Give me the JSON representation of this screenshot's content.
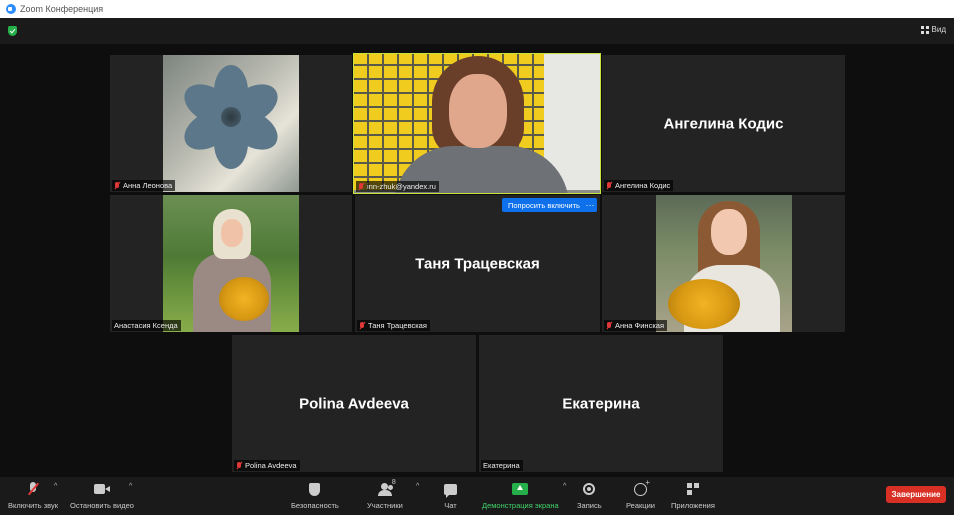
{
  "window": {
    "title": "Zoom Конференция"
  },
  "topbar": {
    "view_label": "Вид"
  },
  "participants": [
    {
      "name": "Анна Леонова",
      "video": true,
      "muted": true
    },
    {
      "name": "inn-zhuk@yandex.ru",
      "video": true,
      "muted": true,
      "active_speaker": true
    },
    {
      "name": "Ангелина Кодис",
      "video": false,
      "muted": true
    },
    {
      "name": "Анастасия Ксенда",
      "video": true,
      "muted": false
    },
    {
      "name": "Таня Трацевская",
      "video": false,
      "muted": true
    },
    {
      "name": "Анна Финская",
      "video": true,
      "muted": true
    },
    {
      "name": "Polina Avdeeva",
      "video": false,
      "muted": true
    },
    {
      "name": "Екатерина",
      "video": false,
      "muted": false
    }
  ],
  "tile_actions": {
    "ask_unmute": "Попросить включить",
    "more": "···"
  },
  "toolbar": {
    "unmute": "Включить звук",
    "start_video": "Остановить видео",
    "security": "Безопасность",
    "participants": "Участники",
    "participants_count": "8",
    "chat": "Чат",
    "share_screen": "Демонстрация экрана",
    "record": "Запись",
    "reactions": "Реакции",
    "apps": "Приложения",
    "end": "Завершение"
  },
  "colors": {
    "accent": "#0e71eb",
    "active_border": "#c7e23a",
    "end": "#d93025",
    "share": "#26b04a"
  }
}
